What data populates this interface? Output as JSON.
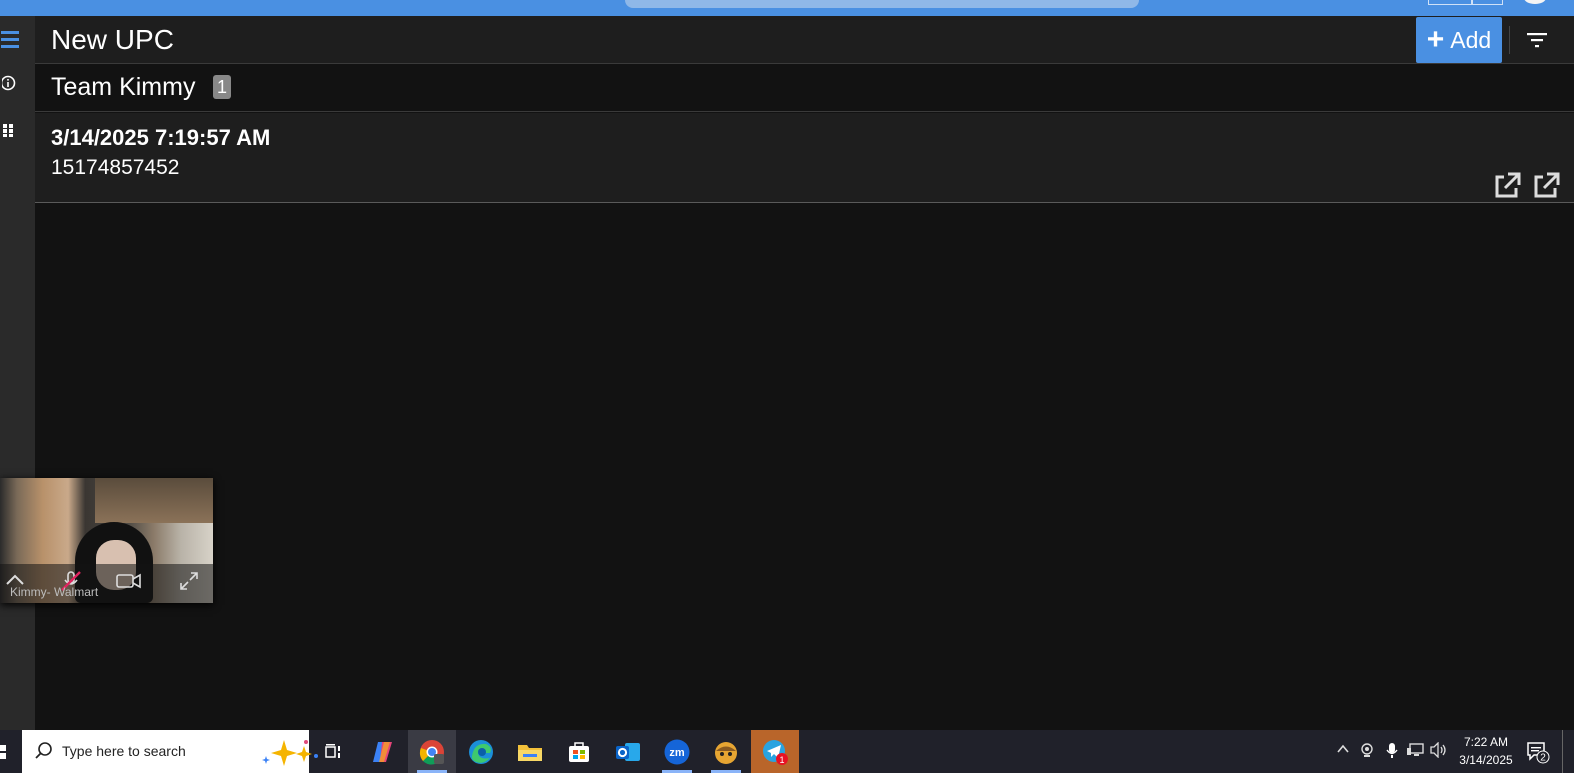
{
  "header": {
    "title": "New UPC",
    "add_label": "Add"
  },
  "group": {
    "title": "Team Kimmy",
    "count": "1"
  },
  "records": [
    {
      "timestamp": "3/14/2025 7:19:57 AM",
      "upc": "15174857452"
    }
  ],
  "video": {
    "participant_name": "Kimmy- Walmart"
  },
  "taskbar": {
    "search_placeholder": "Type here to search",
    "time": "7:22 AM",
    "date": "3/14/2025",
    "notification_count": "2",
    "telegram_badge": "1",
    "zoom_label": "zm"
  },
  "colors": {
    "accent": "#4a90e2",
    "header_bg": "#1e1e1e",
    "page_bg": "#121212",
    "rail_bg": "#2a2a2a",
    "taskbar_bg": "#20212a"
  },
  "icons": [
    "menu-icon",
    "info-icon",
    "apps-grid-icon",
    "plus-icon",
    "filter-icon",
    "external-link-icon",
    "chevron-up-icon",
    "mic-muted-icon",
    "camera-icon",
    "expand-icon",
    "windows-icon",
    "search-icon",
    "copilot-sparkle-icon",
    "task-view-icon",
    "copilot-icon",
    "chrome-icon",
    "edge-icon",
    "file-explorer-icon",
    "store-icon",
    "outlook-icon",
    "zoom-icon",
    "game-icon",
    "telegram-icon",
    "notification-icon"
  ]
}
